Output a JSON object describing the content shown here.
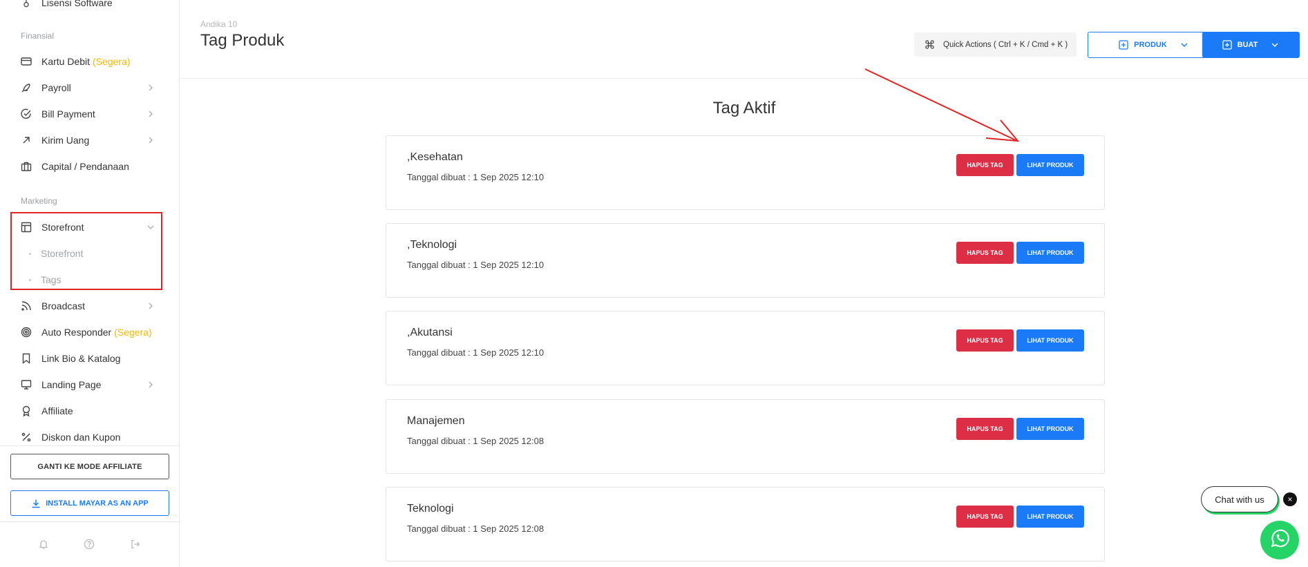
{
  "sidebar": {
    "top_partial_item": "Lisensi Software",
    "sections": {
      "finansial": "Finansial",
      "marketing": "Marketing"
    },
    "finansial_items": [
      {
        "label": "Kartu Debit",
        "badge": "(Segera)",
        "icon": "credit-card-icon"
      },
      {
        "label": "Payroll",
        "icon": "feather-icon"
      },
      {
        "label": "Bill Payment",
        "icon": "check-circle-icon"
      },
      {
        "label": "Kirim Uang",
        "icon": "arrow-up-right-icon"
      },
      {
        "label": "Capital / Pendanaan",
        "icon": "briefcase-icon"
      }
    ],
    "marketing_items": [
      {
        "label": "Storefront",
        "icon": "layout-icon"
      },
      {
        "label": "Broadcast",
        "icon": "rss-icon"
      },
      {
        "label": "Auto Responder",
        "badge": "(Segera)",
        "icon": "target-icon"
      },
      {
        "label": "Link Bio & Katalog",
        "icon": "bookmark-icon"
      },
      {
        "label": "Landing Page",
        "icon": "monitor-icon"
      },
      {
        "label": "Affiliate",
        "icon": "award-icon"
      },
      {
        "label": "Diskon dan Kupon",
        "icon": "percent-icon"
      }
    ],
    "storefront_sub": [
      "Storefront",
      "Tags"
    ],
    "affiliate_mode_button": "GANTI KE MODE AFFILIATE",
    "install_button": "INSTALL MAYAR AS AN APP"
  },
  "header": {
    "breadcrumb": "Andika 10",
    "title": "Tag Produk",
    "quick_actions": "Quick Actions ( Ctrl + K / Cmd + K )",
    "produk_button": "PRODUK",
    "buat_button": "BUAT"
  },
  "main": {
    "section_title": "Tag Aktif",
    "delete_label": "HAPUS TAG",
    "view_label": "LIHAT PRODUK",
    "tags": [
      {
        "name": ",Kesehatan",
        "date": "Tanggal dibuat : 1 Sep 2025 12:10"
      },
      {
        "name": ",Teknologi",
        "date": "Tanggal dibuat : 1 Sep 2025 12:10"
      },
      {
        "name": ",Akutansi",
        "date": "Tanggal dibuat : 1 Sep 2025 12:10"
      },
      {
        "name": "Manajemen",
        "date": "Tanggal dibuat : 1 Sep 2025 12:08"
      },
      {
        "name": "Teknologi",
        "date": "Tanggal dibuat : 1 Sep 2025 12:08"
      }
    ]
  },
  "chat": {
    "label": "Chat with us",
    "close": "×"
  },
  "colors": {
    "primary": "#1a7af8",
    "danger": "#dc2f45",
    "badge": "#f5b800",
    "annotation": "#e02424",
    "whatsapp": "#25d366"
  }
}
